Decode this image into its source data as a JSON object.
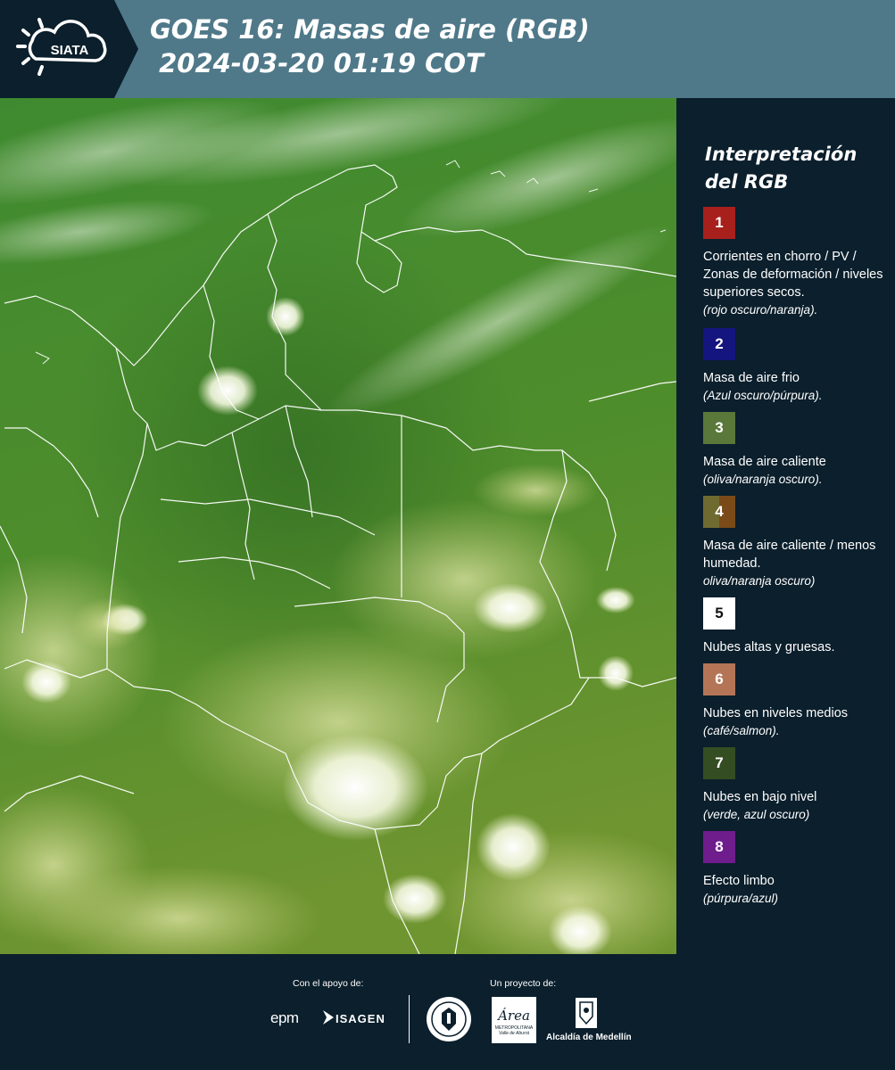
{
  "header": {
    "logo_text": "SIATA",
    "title": "GOES 16: Masas de aire (RGB)\n 2024-03-20 01:19 COT"
  },
  "legend": {
    "title": "Interpretación del RGB",
    "items": [
      {
        "number": "1",
        "color": "#a8201c",
        "description": "Corrientes en chorro / PV / Zonas de deformación / niveles superiores secos.",
        "note": "(rojo oscuro/naranja)."
      },
      {
        "number": "2",
        "color": "#14157f",
        "description": "Masa de aire frio",
        "note": "(Azul oscuro/púrpura)."
      },
      {
        "number": "3",
        "color": "#59783a",
        "description": "Masa de aire caliente",
        "note": "(oliva/naranja oscuro)."
      },
      {
        "number": "4",
        "color": "#6f5a1c",
        "description": "Masa de aire caliente / menos humedad.",
        "note": "oliva/naranja oscuro)"
      },
      {
        "number": "5",
        "color": "#ffffff",
        "description": "Nubes altas y gruesas.",
        "note": ""
      },
      {
        "number": "6",
        "color": "#b47556",
        "description": "Nubes en niveles medios",
        "note": "(café/salmon)."
      },
      {
        "number": "7",
        "color": "#344d22",
        "description": "Nubes en bajo nivel",
        "note": "(verde, azul oscuro)"
      },
      {
        "number": "8",
        "color": "#6f1c8c",
        "description": "Efecto limbo",
        "note": "(púrpura/azul)"
      }
    ]
  },
  "footer": {
    "support_label": "Con el apoyo de:",
    "project_label": "Un proyecto de:",
    "sponsors": [
      "epm",
      "ISAGEN"
    ],
    "area_name": "Área",
    "area_sub": "METROPOLITANA",
    "area_sub2": "Valle de Aburrá",
    "alcaldia": "Alcaldía de Medellín"
  },
  "colors": {
    "header_bg": "#4f7989",
    "logo_bg": "#0b1f2c",
    "panel_bg": "#0b1f2c",
    "map_green": "#4f8a2c",
    "cloud": "#ffffff"
  }
}
